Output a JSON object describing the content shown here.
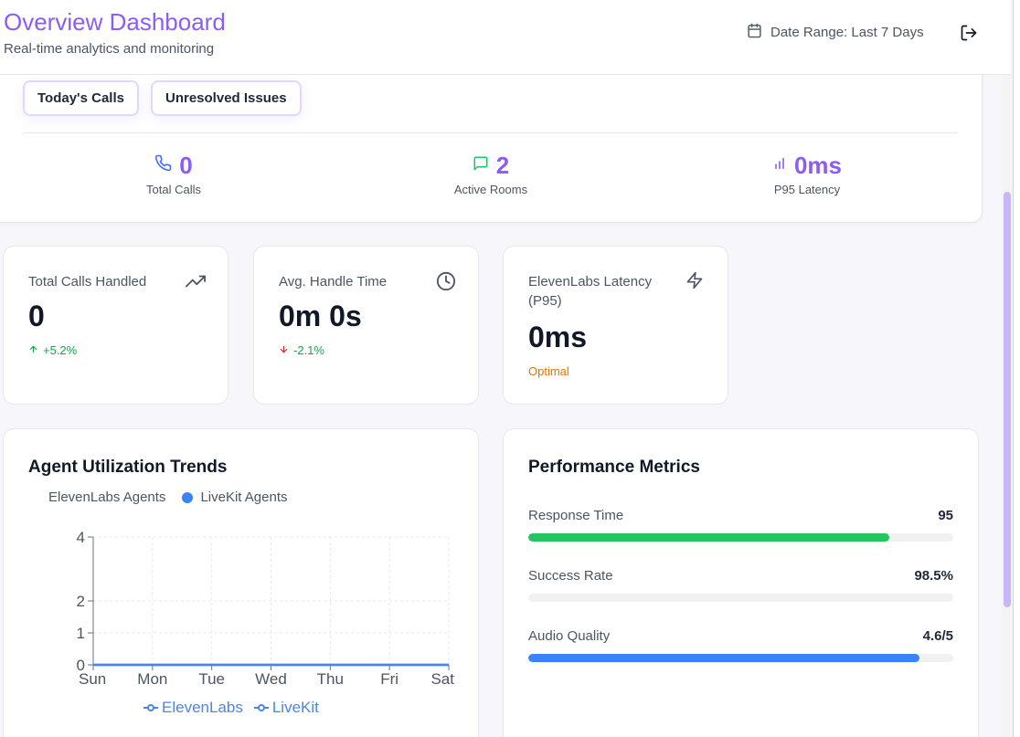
{
  "header": {
    "title": "Overview Dashboard",
    "subtitle": "Real-time analytics and monitoring",
    "date_range": "Date Range: Last 7 Days",
    "icons": {
      "calendar": "calendar-icon",
      "logout": "logout-icon"
    }
  },
  "filters": [
    {
      "label": "Today's Calls"
    },
    {
      "label": "Unresolved Issues"
    }
  ],
  "summary": [
    {
      "value": "0",
      "label": "Total Calls",
      "icon": "phone-icon",
      "color": "#4a6cf7"
    },
    {
      "value": "2",
      "label": "Active Rooms",
      "icon": "message-square-icon",
      "color": "#22c55e"
    },
    {
      "value": "0ms",
      "label": "P95 Latency",
      "icon": "signal-icon",
      "color": "#8b5cf6"
    }
  ],
  "kpis": [
    {
      "label": "Total Calls Handled",
      "value": "0",
      "delta": "+5.2%",
      "direction": "up",
      "icon": "trending-up-icon"
    },
    {
      "label": "Avg. Handle Time",
      "value": "0m 0s",
      "delta": "-2.1%",
      "direction": "down",
      "icon": "clock-icon"
    },
    {
      "label": "ElevenLabs Latency (P95)",
      "value": "0ms",
      "status": "Optimal",
      "icon": "zap-icon"
    }
  ],
  "utilization": {
    "title": "Agent Utilization Trends",
    "legend_top": {
      "series_a": "ElevenLabs Agents",
      "series_b": "LiveKit Agents"
    },
    "legend_bottom": {
      "series_a": "ElevenLabs",
      "series_b": "LiveKit"
    }
  },
  "chart_data": {
    "type": "line",
    "x": [
      "Sun",
      "Mon",
      "Tue",
      "Wed",
      "Thu",
      "Fri",
      "Sat"
    ],
    "yticks": [
      "0",
      "1",
      "2",
      "4"
    ],
    "ylim": [
      0,
      4
    ],
    "series": [
      {
        "name": "ElevenLabs",
        "values": [
          0,
          0,
          0,
          0,
          0,
          0,
          0
        ],
        "color": "#4a86e8"
      },
      {
        "name": "LiveKit",
        "values": [
          0,
          0,
          0,
          0,
          0,
          0,
          0
        ],
        "color": "#4a86e8"
      }
    ],
    "grid": true
  },
  "performance": {
    "title": "Performance Metrics",
    "metrics": [
      {
        "label": "Response Time",
        "value": "95",
        "fraction": 0.85,
        "color": "#22c55e"
      },
      {
        "label": "Success Rate",
        "value": "98.5%",
        "fraction": 0.0,
        "color": "#22c55e"
      },
      {
        "label": "Audio Quality",
        "value": "4.6/5",
        "fraction": 0.92,
        "color": "#3b82f6"
      }
    ]
  },
  "colors": {
    "accent": "#8b5cf6",
    "positive": "#16a34a",
    "negative": "#dc2626",
    "warning": "#d97706"
  }
}
